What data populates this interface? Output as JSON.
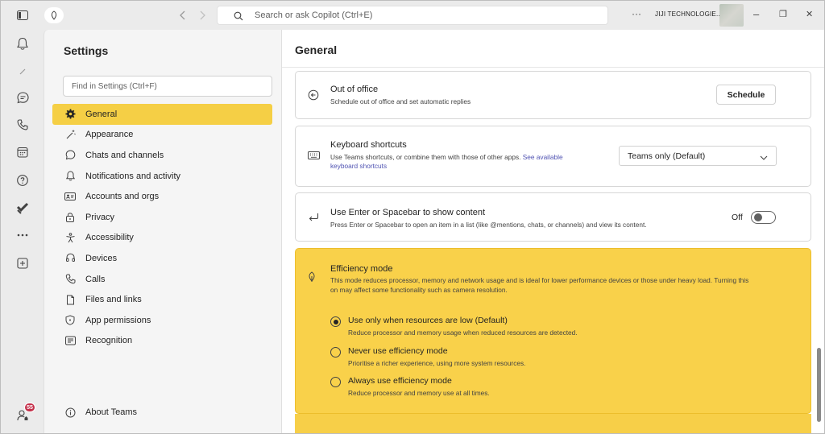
{
  "titlebar": {
    "search_placeholder": "Search or ask Copilot (Ctrl+E)",
    "more_label": "···",
    "org_name": "JIJI TECHNOLOGIE...",
    "minimize": "–",
    "restore": "❐",
    "close": "✕"
  },
  "rail": {
    "badge_count": "55"
  },
  "settings": {
    "title": "Settings",
    "find_placeholder": "Find in Settings (Ctrl+F)",
    "items": [
      {
        "label": "General",
        "icon": "gear-icon",
        "active": true
      },
      {
        "label": "Appearance",
        "icon": "magic-wand-icon"
      },
      {
        "label": "Chats and channels",
        "icon": "chat-icon"
      },
      {
        "label": "Notifications and activity",
        "icon": "bell-icon"
      },
      {
        "label": "Accounts and orgs",
        "icon": "id-card-icon"
      },
      {
        "label": "Privacy",
        "icon": "lock-icon"
      },
      {
        "label": "Accessibility",
        "icon": "accessibility-icon"
      },
      {
        "label": "Devices",
        "icon": "headset-icon"
      },
      {
        "label": "Calls",
        "icon": "phone-icon"
      },
      {
        "label": "Files and links",
        "icon": "document-icon"
      },
      {
        "label": "App permissions",
        "icon": "shield-icon"
      },
      {
        "label": "Recognition",
        "icon": "recognition-icon"
      }
    ],
    "about": "About Teams",
    "active_color": "#f5cf45"
  },
  "main": {
    "title": "General",
    "out_of_office": {
      "title": "Out of office",
      "desc": "Schedule out of office and set automatic replies",
      "button": "Schedule"
    },
    "keyboard": {
      "title": "Keyboard shortcuts",
      "desc": "Use Teams shortcuts, or combine them with those of other apps.",
      "link_1": "See available",
      "link_2": "keyboard shortcuts",
      "select_value": "Teams only (Default)"
    },
    "enter_space": {
      "title": "Use Enter or Spacebar to show content",
      "desc": "Press Enter or Spacebar to open an item in a list (like @mentions, chats, or channels) and view its content.",
      "toggle_label": "Off",
      "toggle_on": false
    },
    "efficiency": {
      "title": "Efficiency mode",
      "desc_line1": "This mode reduces processor, memory and network usage and is ideal for lower performance devices or those under heavy load. Turning this",
      "desc_line2": "on may affect some functionality such as camera resolution.",
      "highlight_color": "#f9d14a",
      "options": [
        {
          "title": "Use only when resources are low (Default)",
          "desc": "Reduce processor and memory usage when reduced resources are detected.",
          "checked": true
        },
        {
          "title": "Never use efficiency mode",
          "desc": "Prioritise a richer experience, using more system resources.",
          "checked": false
        },
        {
          "title": "Always use efficiency mode",
          "desc": "Reduce processor and memory use at all times.",
          "checked": false
        }
      ]
    }
  }
}
